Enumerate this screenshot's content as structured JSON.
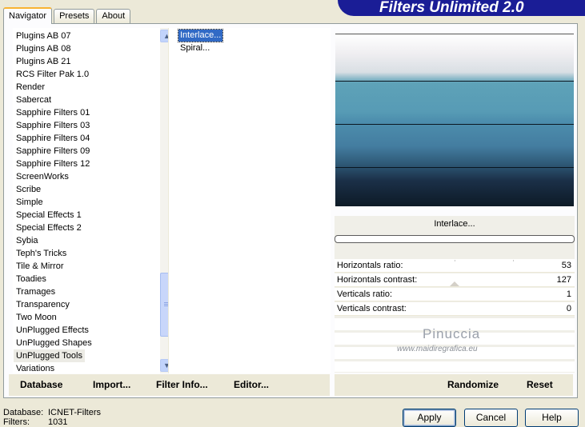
{
  "tabs": [
    "Navigator",
    "Presets",
    "About"
  ],
  "banner_title": "Filters Unlimited 2.0",
  "categories": [
    "Plugins AB 07",
    "Plugins AB 08",
    "Plugins AB 21",
    "RCS Filter Pak 1.0",
    "Render",
    "Sabercat",
    "Sapphire Filters 01",
    "Sapphire Filters 03",
    "Sapphire Filters 04",
    "Sapphire Filters 09",
    "Sapphire Filters 12",
    "ScreenWorks",
    "Scribe",
    "Simple",
    "Special Effects 1",
    "Special Effects 2",
    "Sybia",
    "Teph's Tricks",
    "Tile & Mirror",
    "Toadies",
    "Tramages",
    "Transparency",
    "Two Moon",
    "UnPlugged Effects",
    "UnPlugged Shapes",
    "UnPlugged Tools",
    "Variations"
  ],
  "selected_category": "UnPlugged Tools",
  "filters": [
    "Interlace...",
    "Spiral..."
  ],
  "selected_filter": "Interlace...",
  "filter_title": "Interlace...",
  "params": [
    {
      "label": "Horizontals ratio:",
      "value": "53"
    },
    {
      "label": "Horizontals contrast:",
      "value": "127"
    },
    {
      "label": "Verticals ratio:",
      "value": "1"
    },
    {
      "label": "Verticals contrast:",
      "value": "0"
    }
  ],
  "watermark": {
    "name": "Pinuccia",
    "site": "www.maidiregrafica.eu"
  },
  "bottom_buttons": {
    "database": "Database",
    "import": "Import...",
    "filter_info": "Filter Info...",
    "editor": "Editor...",
    "randomize": "Randomize",
    "reset": "Reset"
  },
  "status": {
    "database_label": "Database:",
    "database_value": "ICNET-Filters",
    "filters_label": "Filters:",
    "filters_value": "1031"
  },
  "dialog_buttons": {
    "apply": "Apply",
    "cancel": "Cancel",
    "help": "Help"
  },
  "colors": {
    "banner": "#1a1d96",
    "selection": "#316ac5",
    "tab_accent": "#f8b332"
  }
}
